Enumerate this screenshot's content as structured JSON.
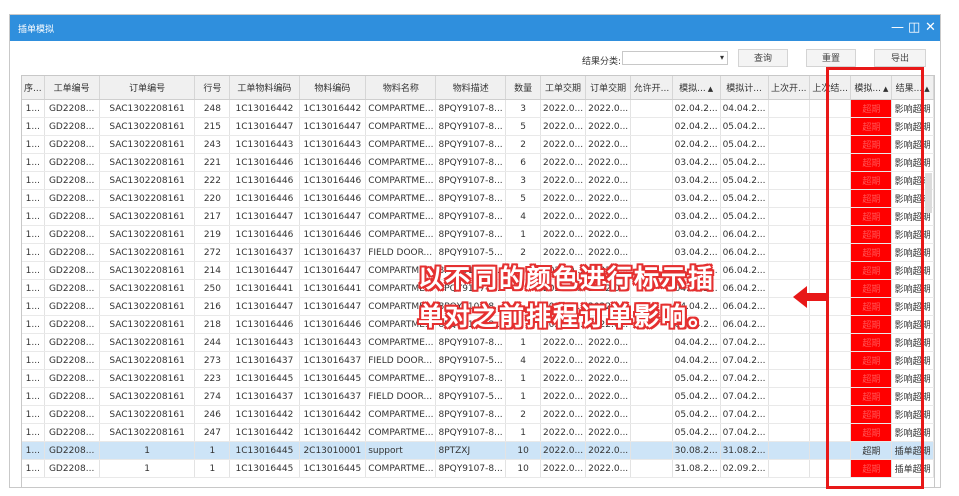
{
  "window": {
    "title": "插单模拟",
    "btn_min": "—",
    "btn_restore": "◫",
    "btn_close": "✕"
  },
  "toolbar": {
    "filter_label": "结果分类:",
    "filter_value": "",
    "query": "查询",
    "reset": "重置",
    "export": "导出"
  },
  "columns": [
    "序...",
    "工单编号",
    "订单编号",
    "行号",
    "工单物料编码",
    "物料编码",
    "物料名称",
    "物料描述",
    "数量",
    "工单交期",
    "订单交期",
    "允许开...",
    "模拟...",
    "模拟计...",
    "上次开...",
    "上次结...",
    "模拟...",
    "结果..."
  ],
  "rows": [
    [
      "1...",
      "GD2208...",
      "SAC1302208161",
      "248",
      "1C13016442",
      "1C13016442",
      "COMPARTME...",
      "8PQY9107-8...",
      "3",
      "2022.0...",
      "2022.0...",
      "",
      "02.04.2...",
      "04.04.2...",
      "",
      "",
      "超期",
      "影响超期"
    ],
    [
      "1...",
      "GD2208...",
      "SAC1302208161",
      "215",
      "1C13016447",
      "1C13016447",
      "COMPARTME...",
      "8PQY9107-8...",
      "5",
      "2022.0...",
      "2022.0...",
      "",
      "02.04.2...",
      "05.04.2...",
      "",
      "",
      "超期",
      "影响超期"
    ],
    [
      "1...",
      "GD2208...",
      "SAC1302208161",
      "243",
      "1C13016443",
      "1C13016443",
      "COMPARTME...",
      "8PQY9107-8...",
      "2",
      "2022.0...",
      "2022.0...",
      "",
      "02.04.2...",
      "05.04.2...",
      "",
      "",
      "超期",
      "影响超期"
    ],
    [
      "1...",
      "GD2208...",
      "SAC1302208161",
      "221",
      "1C13016446",
      "1C13016446",
      "COMPARTME...",
      "8PQY9107-8...",
      "6",
      "2022.0...",
      "2022.0...",
      "",
      "03.04.2...",
      "05.04.2...",
      "",
      "",
      "超期",
      "影响超期"
    ],
    [
      "1...",
      "GD2208...",
      "SAC1302208161",
      "222",
      "1C13016446",
      "1C13016446",
      "COMPARTME...",
      "8PQY9107-8...",
      "3",
      "2022.0...",
      "2022.0...",
      "",
      "03.04.2...",
      "05.04.2...",
      "",
      "",
      "超期",
      "影响超期"
    ],
    [
      "1...",
      "GD2208...",
      "SAC1302208161",
      "220",
      "1C13016446",
      "1C13016446",
      "COMPARTME...",
      "8PQY9107-8...",
      "5",
      "2022.0...",
      "2022.0...",
      "",
      "03.04.2...",
      "05.04.2...",
      "",
      "",
      "超期",
      "影响超期"
    ],
    [
      "1...",
      "GD2208...",
      "SAC1302208161",
      "217",
      "1C13016447",
      "1C13016447",
      "COMPARTME...",
      "8PQY9107-8...",
      "4",
      "2022.0...",
      "2022.0...",
      "",
      "03.04.2...",
      "05.04.2...",
      "",
      "",
      "超期",
      "影响超期"
    ],
    [
      "1...",
      "GD2208...",
      "SAC1302208161",
      "219",
      "1C13016446",
      "1C13016446",
      "COMPARTME...",
      "8PQY9107-8...",
      "1",
      "2022.0...",
      "2022.0...",
      "",
      "03.04.2...",
      "06.04.2...",
      "",
      "",
      "超期",
      "影响超期"
    ],
    [
      "1...",
      "GD2208...",
      "SAC1302208161",
      "272",
      "1C13016437",
      "1C13016437",
      "FIELD DOOR...",
      "8PQY9107-5...",
      "2",
      "2022.0...",
      "2022.0...",
      "",
      "03.04.2...",
      "06.04.2...",
      "",
      "",
      "超期",
      "影响超期"
    ],
    [
      "1...",
      "GD2208...",
      "SAC1302208161",
      "214",
      "1C13016447",
      "1C13016447",
      "COMPARTME...",
      "8PQY9107-8...",
      "",
      "2022.0...",
      "2022.0...",
      "",
      "04.04.2...",
      "06.04.2...",
      "",
      "",
      "超期",
      "影响超期"
    ],
    [
      "1...",
      "GD2208...",
      "SAC1302208161",
      "250",
      "1C13016441",
      "1C13016441",
      "COMPARTME...",
      "8PQY9107-8...",
      "",
      "2022.0...",
      "2022.0...",
      "",
      "04.04.2...",
      "06.04.2...",
      "",
      "",
      "超期",
      "影响超期"
    ],
    [
      "1...",
      "GD2208...",
      "SAC1302208161",
      "216",
      "1C13016447",
      "1C13016447",
      "COMPARTME...",
      "8PQY9107-8...",
      "",
      "2022.0...",
      "2022.0...",
      "",
      "04.04.2...",
      "06.04.2...",
      "",
      "",
      "超期",
      "影响超期"
    ],
    [
      "1...",
      "GD2208...",
      "SAC1302208161",
      "218",
      "1C13016446",
      "1C13016446",
      "COMPARTME...",
      "8PQY9107-8...",
      "",
      "2022.0...",
      "2022.0...",
      "",
      "04.04.2...",
      "06.04.2...",
      "",
      "",
      "超期",
      "影响超期"
    ],
    [
      "1...",
      "GD2208...",
      "SAC1302208161",
      "244",
      "1C13016443",
      "1C13016443",
      "COMPARTME...",
      "8PQY9107-8...",
      "1",
      "2022.0...",
      "2022.0...",
      "",
      "04.04.2...",
      "07.04.2...",
      "",
      "",
      "超期",
      "影响超期"
    ],
    [
      "1...",
      "GD2208...",
      "SAC1302208161",
      "273",
      "1C13016437",
      "1C13016437",
      "FIELD DOOR...",
      "8PQY9107-5...",
      "4",
      "2022.0...",
      "2022.0...",
      "",
      "04.04.2...",
      "07.04.2...",
      "",
      "",
      "超期",
      "影响超期"
    ],
    [
      "1...",
      "GD2208...",
      "SAC1302208161",
      "223",
      "1C13016445",
      "1C13016445",
      "COMPARTME...",
      "8PQY9107-8...",
      "1",
      "2022.0...",
      "2022.0...",
      "",
      "05.04.2...",
      "07.04.2...",
      "",
      "",
      "超期",
      "影响超期"
    ],
    [
      "1...",
      "GD2208...",
      "SAC1302208161",
      "274",
      "1C13016437",
      "1C13016437",
      "FIELD DOOR...",
      "8PQY9107-5...",
      "1",
      "2022.0...",
      "2022.0...",
      "",
      "05.04.2...",
      "07.04.2...",
      "",
      "",
      "超期",
      "影响超期"
    ],
    [
      "1...",
      "GD2208...",
      "SAC1302208161",
      "246",
      "1C13016442",
      "1C13016442",
      "COMPARTME...",
      "8PQY9107-8...",
      "2",
      "2022.0...",
      "2022.0...",
      "",
      "05.04.2...",
      "07.04.2...",
      "",
      "",
      "超期",
      "影响超期"
    ],
    [
      "1...",
      "GD2208...",
      "SAC1302208161",
      "247",
      "1C13016442",
      "1C13016442",
      "COMPARTME...",
      "8PQY9107-8...",
      "1",
      "2022.0...",
      "2022.0...",
      "",
      "05.04.2...",
      "07.04.2...",
      "",
      "",
      "超期",
      "影响超期"
    ],
    [
      "1...",
      "GD2208...",
      "1",
      "1",
      "1C13016445",
      "2C13010001",
      "support",
      "8PTZXJ",
      "10",
      "2022.0...",
      "2022.0...",
      "",
      "30.08.2...",
      "31.08.2...",
      "",
      "",
      "超期",
      "插单超期"
    ],
    [
      "1...",
      "GD2208...",
      "1",
      "1",
      "1C13016445",
      "1C13016445",
      "COMPARTME...",
      "8PQY9107-8...",
      "10",
      "2022.0...",
      "2022.0...",
      "",
      "31.08.2...",
      "02.09.2...",
      "",
      "",
      "超期",
      "插单超期"
    ]
  ],
  "selected_row": 19,
  "annotation": {
    "line1": "以不同的颜色进行标示插",
    "line2": "单对之前排程订单影响。",
    "highlight_color": "#e81818"
  },
  "colors": {
    "title_bar": "#2f8fdd",
    "overdue_red": "#ff0000",
    "selected_row": "#cde4f7"
  }
}
